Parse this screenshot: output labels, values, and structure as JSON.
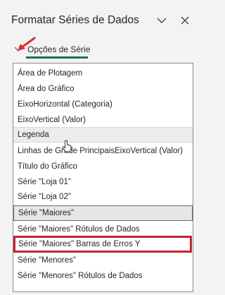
{
  "pane": {
    "title": "Formatar Séries de Dados",
    "collapse_icon": "chevron-down-icon",
    "close_icon": "close-icon"
  },
  "series_options": {
    "label": "Opções de Série",
    "icon": "chevron-down-icon",
    "underline_color": "#1f7244"
  },
  "annotation": {
    "arrow_color": "#e32b2b",
    "highlight_color": "#c0262d"
  },
  "dropdown": {
    "items": [
      {
        "label": "Área de Plotagem"
      },
      {
        "label": "Área do Gráfico"
      },
      {
        "label": "EixoHorizontal (Categoria)"
      },
      {
        "label": "EixoVertical (Valor)"
      },
      {
        "label": "Legenda"
      },
      {
        "label": "Linhas de Grade PrincipaisEixoVertical (Valor)"
      },
      {
        "label": "Título do Gráfico"
      },
      {
        "label": "Série \"Loja 01\""
      },
      {
        "label": "Série \"Loja 02\""
      },
      {
        "label": "Série \"Maiores\""
      },
      {
        "label": "Série \"Maiores\" Rótulos de Dados"
      },
      {
        "label": "Série \"Maiores\" Barras de Erros Y"
      },
      {
        "label": "Série \"Menores\""
      },
      {
        "label": "Série \"Menores\" Rótulos de Dados"
      }
    ],
    "hovered_index": 4,
    "selected_index": 9,
    "highlighted_index": 11
  }
}
